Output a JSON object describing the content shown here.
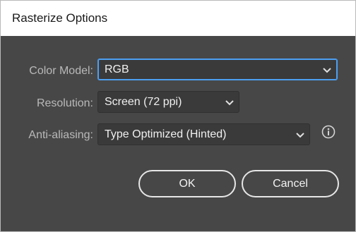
{
  "dialog": {
    "title": "Rasterize Options"
  },
  "fields": {
    "color_model": {
      "label": "Color Model:",
      "value": "RGB"
    },
    "resolution": {
      "label": "Resolution:",
      "value": "Screen (72 ppi)"
    },
    "anti_aliasing": {
      "label": "Anti-aliasing:",
      "value": "Type Optimized (Hinted)"
    }
  },
  "icons": {
    "chevron": "chevron-down-icon",
    "info": "info-icon"
  },
  "buttons": {
    "ok_label": "OK",
    "cancel_label": "Cancel"
  },
  "colors": {
    "background": "#474747",
    "focus_accent": "#4c9ff2",
    "label_text": "#b9b9b9"
  }
}
